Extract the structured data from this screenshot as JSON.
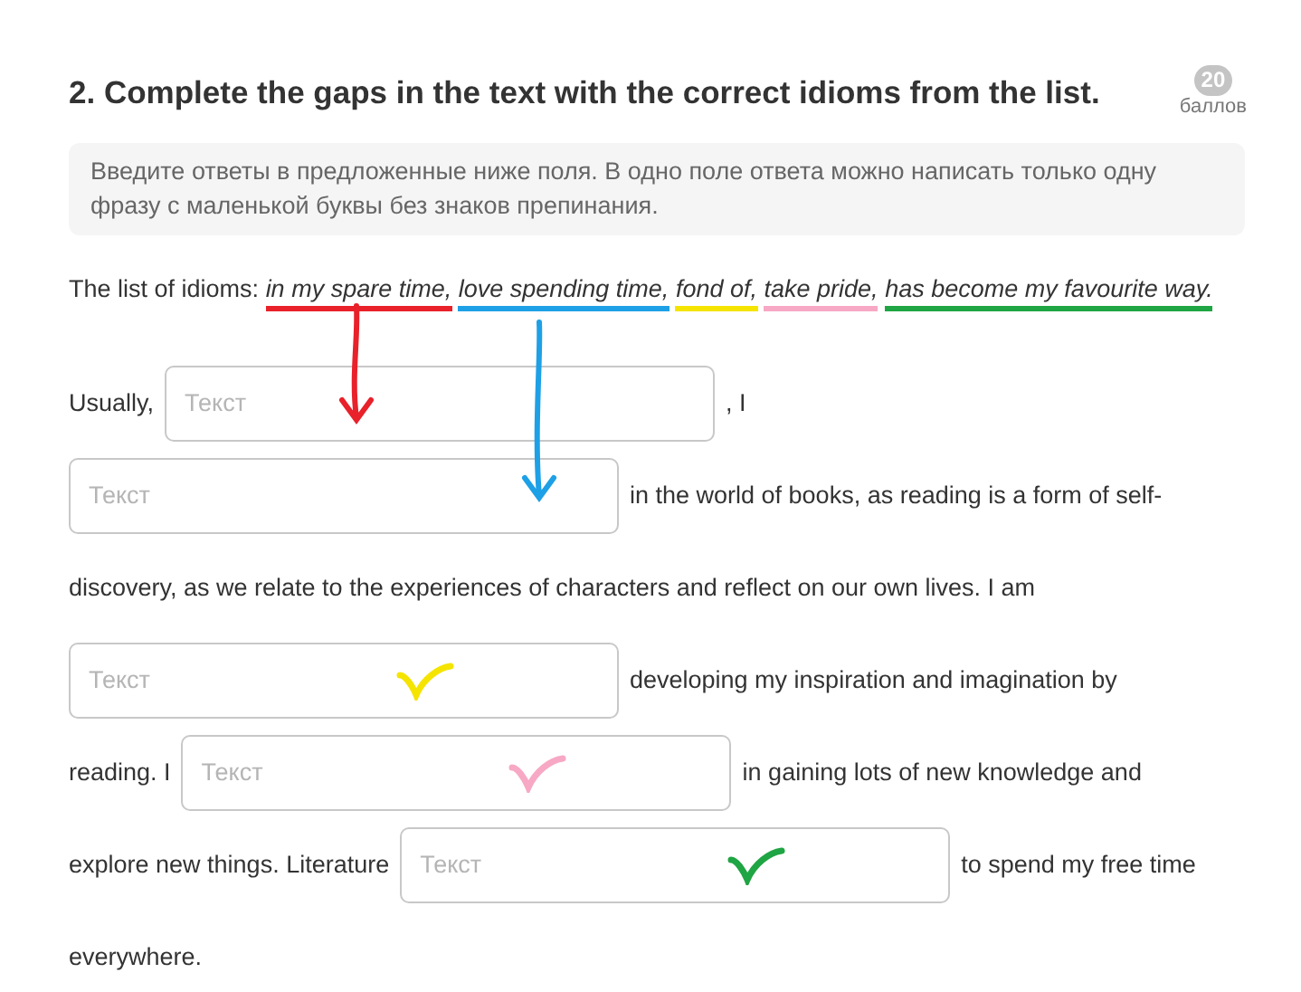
{
  "question": {
    "title": "2. Complete the gaps in the text with the correct idioms from the list.",
    "points": "20",
    "points_label": "баллов"
  },
  "instruction": "Введите ответы в предложенные ниже поля. В одно поле ответа можно написать только одну фразу с маленькой буквы без знаков препинания.",
  "idioms": {
    "label": "The list of idioms:",
    "items": [
      {
        "text": "in my spare time,",
        "color": "#e8212a"
      },
      {
        "text": "love spending time,",
        "color": "#1ea0e6"
      },
      {
        "text": "fond of,",
        "color": "#f5e400"
      },
      {
        "text": "take pride,",
        "color": "#f7a8c4"
      },
      {
        "text": "has become my favourite way.",
        "color": "#1fa543"
      }
    ]
  },
  "passage": [
    [
      {
        "kind": "text",
        "text": "Usually,"
      },
      {
        "kind": "gap",
        "placeholder": "Текст",
        "mark": {
          "kind": "arrow",
          "color": "#e8212a"
        }
      },
      {
        "kind": "text",
        "text": ", I"
      }
    ],
    [
      {
        "kind": "gap",
        "placeholder": "Текст",
        "mark": {
          "kind": "arrow",
          "color": "#1ea0e6"
        }
      },
      {
        "kind": "text",
        "text": "in the world of books, as reading is a form of self-"
      }
    ],
    [
      {
        "kind": "text",
        "text": "discovery, as we relate to the experiences of characters and reflect on our own lives. I am"
      }
    ],
    [
      {
        "kind": "gap",
        "placeholder": "Текст",
        "mark": {
          "kind": "check",
          "color": "#f5e400"
        }
      },
      {
        "kind": "text",
        "text": "developing my inspiration and imagination by"
      }
    ],
    [
      {
        "kind": "text",
        "text": "reading. I"
      },
      {
        "kind": "gap",
        "placeholder": "Текст",
        "mark": {
          "kind": "check",
          "color": "#f7a8c4"
        }
      },
      {
        "kind": "text",
        "text": "in gaining lots of new knowledge and"
      }
    ],
    [
      {
        "kind": "text",
        "text": "explore new things. Literature"
      },
      {
        "kind": "gap",
        "placeholder": "Текст",
        "mark": {
          "kind": "check",
          "color": "#1fa543"
        }
      },
      {
        "kind": "text",
        "text": "to spend my free time"
      }
    ],
    [
      {
        "kind": "text",
        "text": "everywhere."
      }
    ]
  ]
}
